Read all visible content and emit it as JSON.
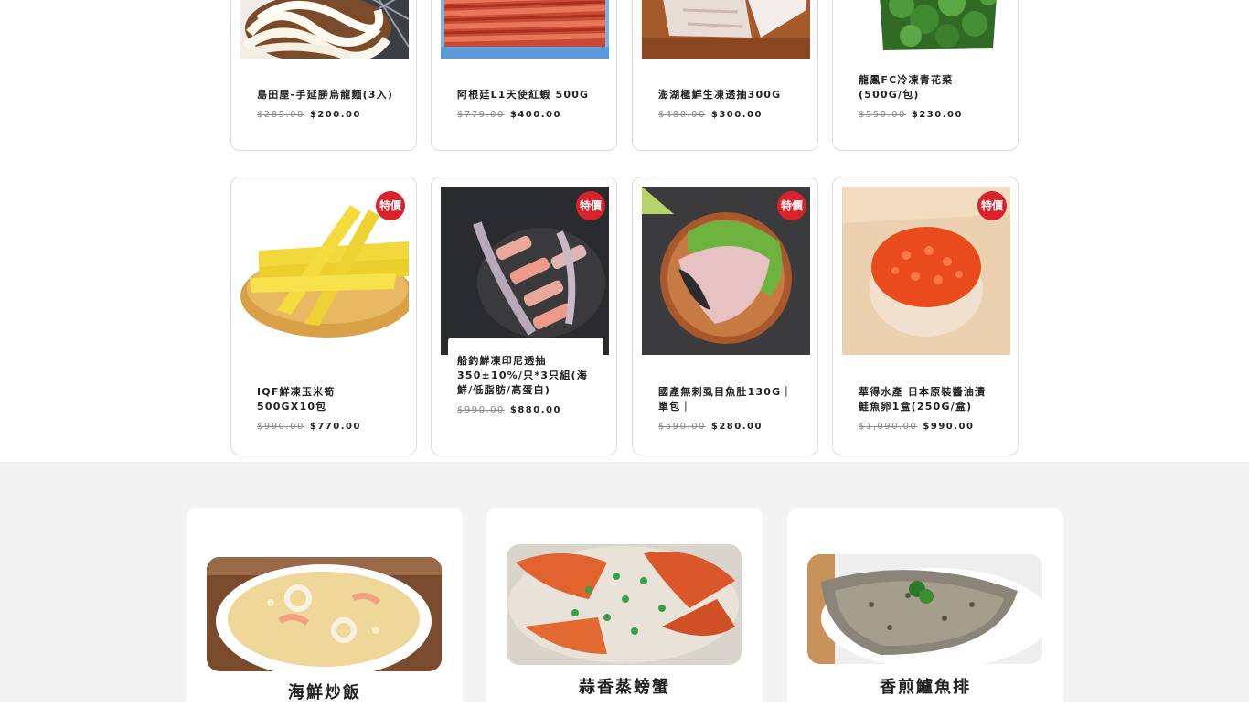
{
  "badge_label": "特價",
  "products_row1": [
    {
      "name": "島田屋-手延勝烏龍麵(3入)",
      "old_price": "$285.00",
      "price": "$200.00",
      "icon": "udon-noodles-photo"
    },
    {
      "name": "阿根廷L1天使紅蝦 500G",
      "old_price": "$779.00",
      "price": "$400.00",
      "icon": "red-shrimp-photo"
    },
    {
      "name": "澎湖極鮮生凍透抽300G",
      "old_price": "$480.00",
      "price": "$300.00",
      "icon": "squid-pack-photo"
    },
    {
      "name": "龍鳳FC冷凍青花菜(500G/包)",
      "old_price": "$550.00",
      "price": "$230.00",
      "icon": "broccoli-bag-photo"
    }
  ],
  "products_row2": [
    {
      "name": "IQF鮮凍玉米筍 500GX10包",
      "old_price": "$990.00",
      "price": "$770.00",
      "icon": "baby-corn-photo"
    },
    {
      "name": "船釣鮮凍印尼透抽350±10%/只*3只組(海鮮/低脂肪/高蛋白)",
      "old_price": "$990.00",
      "price": "$880.00",
      "icon": "sliced-squid-photo"
    },
    {
      "name": "國產無刺虱目魚肚130G｜單包｜",
      "old_price": "$590.00",
      "price": "$280.00",
      "icon": "milkfish-belly-photo"
    },
    {
      "name": "華得水產 日本原裝醬油漬鮭魚卵1盒(250G/盒)",
      "old_price": "$1,090.00",
      "price": "$990.00",
      "icon": "salmon-roe-photo"
    }
  ],
  "recipes": [
    {
      "title": "海鮮炒飯",
      "icon": "seafood-fried-rice-photo"
    },
    {
      "title": "蒜香蒸螃蟹",
      "icon": "garlic-steamed-crab-photo"
    },
    {
      "title": "香煎鱸魚排",
      "icon": "pan-fried-seabass-photo"
    }
  ],
  "colors": {
    "badge": "#d9222a",
    "recipe_bg": "#f4f3f3"
  }
}
